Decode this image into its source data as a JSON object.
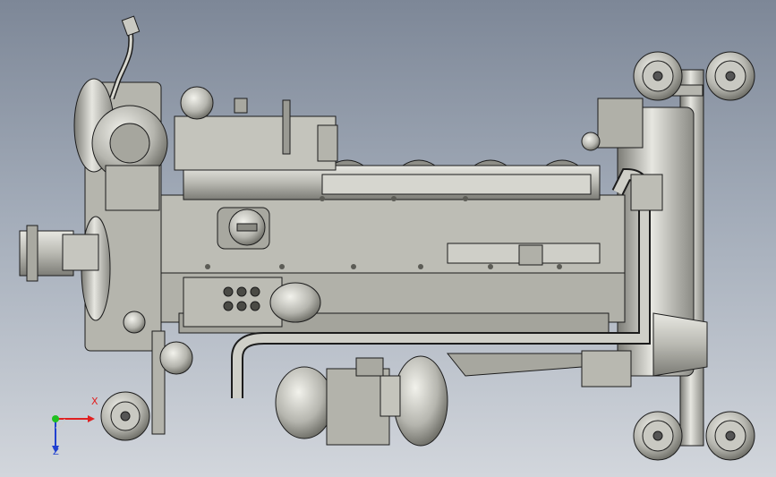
{
  "viewport": {
    "background_top": "#7d8797",
    "background_bottom": "#d2d6dc"
  },
  "model": {
    "subject": "engine-assembly",
    "body_color": "#bdbdb5",
    "shadow_color": "#6e6e68",
    "highlight_color": "#ededE6",
    "edge_color": "#1c1c1c"
  },
  "triad": {
    "x_label": "X",
    "z_label": "Z",
    "x_color": "#e02020",
    "y_color": "#20c020",
    "z_color": "#2040d0"
  }
}
